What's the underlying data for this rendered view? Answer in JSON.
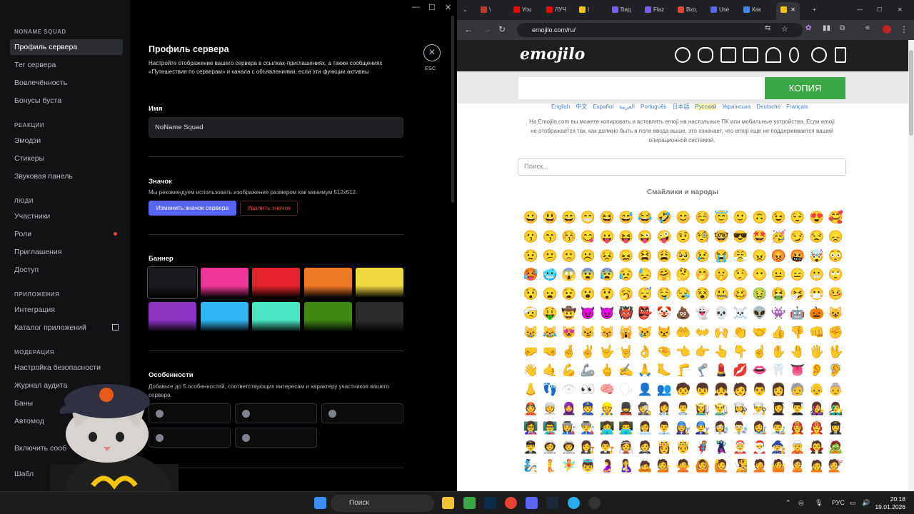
{
  "discord": {
    "sidebar": {
      "sections": [
        {
          "title": "NONAME SQUAD",
          "items": [
            {
              "label": "Профиль сервера",
              "selected": true
            },
            {
              "label": "Тег сервера"
            },
            {
              "label": "Вовлечённость"
            },
            {
              "label": "Бонусы буста"
            }
          ]
        },
        {
          "title": "РЕАКЦИИ",
          "items": [
            {
              "label": "Эмодзи"
            },
            {
              "label": "Стикеры"
            },
            {
              "label": "Звуковая панель"
            }
          ]
        },
        {
          "title": "ЛЮДИ",
          "items": [
            {
              "label": "Участники"
            },
            {
              "label": "Роли",
              "dot": true
            },
            {
              "label": "Приглашения"
            },
            {
              "label": "Доступ"
            }
          ]
        },
        {
          "title": "ПРИЛОЖЕНИЯ",
          "items": [
            {
              "label": "Интеграция"
            },
            {
              "label": "Каталог приложений",
              "external": true
            }
          ]
        },
        {
          "title": "МОДЕРАЦИЯ",
          "items": [
            {
              "label": "Настройка безопасности"
            },
            {
              "label": "Журнал аудита"
            },
            {
              "label": "Баны"
            },
            {
              "label": "Автомод"
            }
          ]
        },
        {
          "title": "",
          "items": [
            {
              "label": "Включить сооб"
            },
            {
              "label": "Шабл"
            }
          ]
        }
      ]
    },
    "main": {
      "title": "Профиль сервера",
      "description": "Настройте отображение вашего сервера в ссылках-приглашениях, а также сообщениях «Путешествия по серверам» и канала с объявлениями, если эти функции активны",
      "name_label": "Имя",
      "name_value": "NoName Squad",
      "icon_label": "Значок",
      "icon_hint": "Мы рекомендуем использовать изображение размером как минимум 512x512.",
      "change_icon_button": "Изменить значок сервера",
      "remove_icon_button": "Удалить значок",
      "banner_label": "Баннер",
      "banner_colors": [
        "#1b1b1f",
        "#f0369a",
        "#e5212b",
        "#ee7a24",
        "#f1d942",
        "#8a33c0",
        "#33b6f5",
        "#48e7c2",
        "#3f8913",
        "#2c2c2c"
      ],
      "traits_label": "Особенности",
      "traits_hint": "Добавьте до 5 особенностей, соответствующих интересам и характеру участников вашего сервера.",
      "esc_label": "ESC"
    }
  },
  "chrome": {
    "tabs": [
      {
        "label": "\\",
        "color": "#c0392b"
      },
      {
        "label": "You",
        "color": "#ff0000"
      },
      {
        "label": "ЛУЧ",
        "color": "#ff0000"
      },
      {
        "label": "I",
        "color": "#f1c40f"
      },
      {
        "label": "Вид",
        "color": "#7b5cff"
      },
      {
        "label": "Flaz",
        "color": "#7b5cff"
      },
      {
        "label": "Вхо,",
        "color": "#ea4335"
      },
      {
        "label": "Use",
        "color": "#5865f2"
      },
      {
        "label": "Как",
        "color": "#4285f4"
      },
      {
        "label": "",
        "color": "#f1c40f",
        "active": true
      }
    ],
    "url": "emojilo.com/ru/",
    "site": {
      "logo": "emojilo",
      "copy_button": "КОПИЯ",
      "languages": [
        "English",
        "中文",
        "Español",
        "العربية",
        "Português",
        "日本語",
        "Русский",
        "Українська",
        "Deutsche",
        "Français"
      ],
      "current_language": "Русский",
      "intro": "На Emojilo.com вы можете копировать и вставлять emoji на настольные ПК или мобильные устройства. Если emoji не отображается так, как должно быть в поле ввода выше, это означает, что emoji еще не поддерживается вашей операционной системой.",
      "search_placeholder": "Поиск...",
      "category_title": "Смайлики и народы",
      "emoji_rows": [
        "😀😃😄😁😆😅😂🤣😊☺️😇🙂🙃😉😌😍🥰",
        "😗😙😚😋😛😝😜🤪🤨🧐🤓😎🤩🥳😏😒😞",
        "😟😕🙁☹️😣😖😫😩🥺😢😭😤😠😡🤬🤯😳",
        "🥵🥶😱😨😰😥😓🤗🤔🤭🤫🤥😶😐😑😬🙄",
        "😯😦😧😮😲🥱😴🤤😪😵🤐🥴🤢🤮🤧😷🤒",
        "🤕🤑🤠😈👿👹👺🤡💩👻💀☠️👽👾🤖🎃😺",
        "😸😹😻😼😽🙀😿😾🤲👐🙌👏🤝👍👎👊✊",
        "🤛🤜🤞✌️🤟🤘👌🤏👈👉👆👇☝️✋🤚🖐🖖",
        "👋🤙💪🦾🖕✍️🙏🦶🦵🦿💄💋👄🦷👅👂🦻",
        "👃👣👁👀🧠🗣👤👥🧒👦👧🧑👨👩🧓👴👵",
        "👲👳🧕👮👷💂🕵️👩‍⚕️👨‍⚕️👩‍🌾👨‍🌾👩‍🍳👨‍🍳👩‍🎓👨‍🎓👩‍🎤👨‍🎤",
        "👩‍🏫👨‍🏫👩‍🏭👨‍🏭👩‍💻👨‍💻👩‍💼👨‍💼👩‍🔧👨‍🔧👩‍🔬👨‍🔬👩‍🎨👨‍🎨👩‍🚒👨‍🚒👩‍✈️",
        "👨‍✈️👩‍🚀👨‍🚀👩‍⚖️👨‍⚖️👰🤵👸🤴🦸🦹🤶🎅🧙🧝🧛🧟",
        "🧞🧜🧚👼🤰🤱🙇💁🙅🙆🙋🧏🤦🤷🙎🙍💇"
      ]
    }
  },
  "taskbar": {
    "search_placeholder": "Поиск",
    "language": "РУС",
    "time": "20:18",
    "date": "19.01.2026"
  }
}
